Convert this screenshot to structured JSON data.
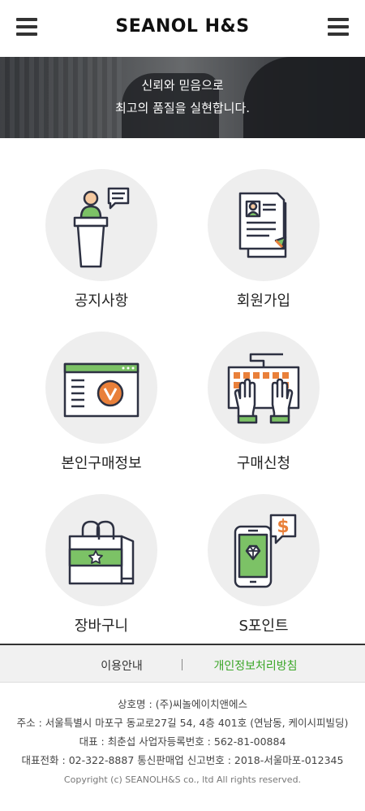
{
  "header": {
    "logo": "SEANOL H&S",
    "menu_left_icon": "hamburger-menu-icon",
    "menu_right_icon": "hamburger-menu-icon"
  },
  "banner": {
    "line1": "신뢰와 믿음으로",
    "line2": "최고의 품질을 실현합니다."
  },
  "menu": [
    {
      "label": "공지사항",
      "icon": "podium-speaker-icon"
    },
    {
      "label": "회원가입",
      "icon": "member-document-icon"
    },
    {
      "label": "본인구매정보",
      "icon": "browser-window-v-icon"
    },
    {
      "label": "구매신청",
      "icon": "hands-keyboard-icon"
    },
    {
      "label": "장바구니",
      "icon": "shopping-bag-icon"
    },
    {
      "label": "S포인트",
      "icon": "phone-diamond-dollar-icon"
    }
  ],
  "links": {
    "usage_guide": "이용안내",
    "privacy_policy": "개인정보처리방침"
  },
  "footer": {
    "company": "상호명 : (주)씨놀에이치앤에스",
    "address": "주소 :  서울특별시 마포구 동교로27길 54, 4층 401호 (연남동, 케이시피빌딩)",
    "ceo_and_biz": "대표 : 최춘섭      사업자등록번호 : 562-81-00884",
    "phone_and_license": "대표전화 :  02-322-8887      통신판매업 신고번호 : 2018-서울마포-012345",
    "copyright": "Copyright (c) SEANOLH&S co., ltd All rights reserved."
  },
  "colors": {
    "accent_green": "#3aa627",
    "icon_green": "#7cc266",
    "icon_orange": "#e9803a",
    "icon_stroke": "#2d3142"
  }
}
